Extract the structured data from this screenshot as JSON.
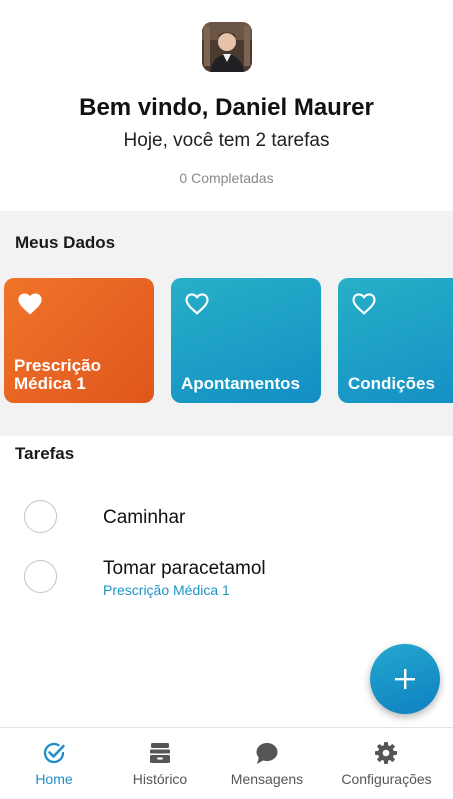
{
  "header": {
    "greeting": "Bem vindo, Daniel Maurer",
    "subtitle": "Hoje, você tem 2 tarefas",
    "completed": "0 Completadas"
  },
  "my_data": {
    "title": "Meus Dados",
    "cards": [
      {
        "label": "Prescrição Médica 1",
        "icon": "heart-filled-icon",
        "color": "#e8632a"
      },
      {
        "label": "Apontamentos",
        "icon": "heart-outline-icon",
        "color": "#1e9fc5"
      },
      {
        "label": "Condições",
        "icon": "heart-outline-icon",
        "color": "#1e9fc5"
      }
    ]
  },
  "tasks": {
    "title": "Tarefas",
    "items": [
      {
        "name": "Caminhar",
        "subtitle": ""
      },
      {
        "name": "Tomar paracetamol",
        "subtitle": "Prescrição Médica 1"
      }
    ]
  },
  "fab": {
    "icon": "plus-icon"
  },
  "nav": {
    "items": [
      {
        "label": "Home",
        "icon": "check-circle-icon",
        "active": true
      },
      {
        "label": "Histórico",
        "icon": "archive-box-icon",
        "active": false
      },
      {
        "label": "Mensagens",
        "icon": "chat-bubble-icon",
        "active": false
      },
      {
        "label": "Configurações",
        "icon": "gear-icon",
        "active": false
      }
    ]
  },
  "colors": {
    "accent": "#1d8fc6",
    "orange": "#e8632a",
    "background": "#f2f2f2"
  }
}
